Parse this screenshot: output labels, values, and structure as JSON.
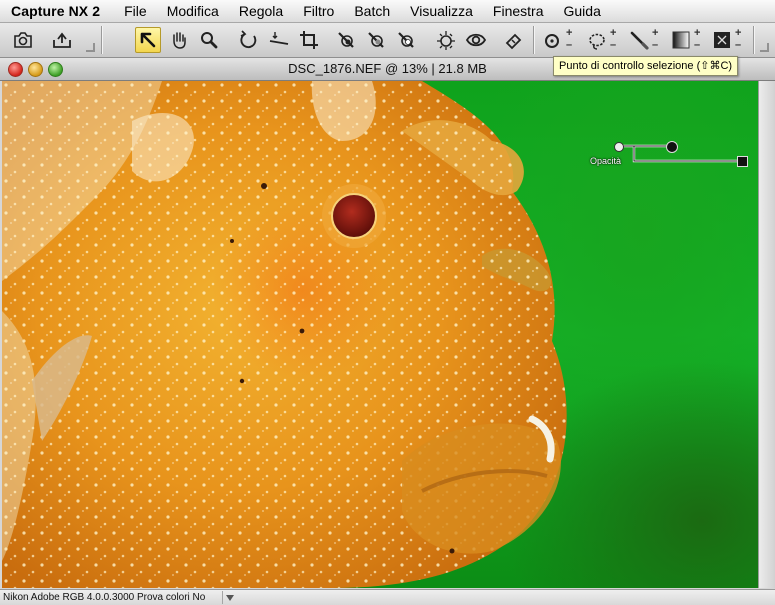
{
  "app": {
    "name": "Capture NX 2"
  },
  "menu": {
    "items": [
      "File",
      "Modifica",
      "Regola",
      "Filtro",
      "Batch",
      "Visualizza",
      "Finestra",
      "Guida"
    ]
  },
  "toolbar": {
    "tools": [
      {
        "name": "camera-icon"
      },
      {
        "name": "export-icon"
      },
      {
        "name": "direct-selection-icon",
        "active": true
      },
      {
        "name": "hand-icon"
      },
      {
        "name": "zoom-icon"
      },
      {
        "name": "rotate-icon"
      },
      {
        "name": "straighten-icon"
      },
      {
        "name": "crop-icon"
      },
      {
        "name": "black-dropper-icon"
      },
      {
        "name": "neutral-dropper-icon"
      },
      {
        "name": "white-dropper-icon"
      },
      {
        "name": "red-eye-icon"
      },
      {
        "name": "eye-icon"
      },
      {
        "name": "auto-retouch-icon"
      },
      {
        "name": "selection-control-point-icon"
      },
      {
        "name": "lasso-icon"
      },
      {
        "name": "brush-icon"
      },
      {
        "name": "gradient-icon"
      },
      {
        "name": "fill-icon"
      }
    ],
    "tooltip": "Punto di controllo selezione (⇧⌘C)"
  },
  "document": {
    "title": "DSC_1876.NEF @ 13% | 21.8 MB",
    "control_point": {
      "label": "Opacità"
    }
  },
  "statusbar": {
    "text": "Nikon Adobe RGB 4.0.0.3000  Prova colori No"
  },
  "colors": {
    "background_green": "#12a522",
    "fish_orange": "#e89a1c",
    "eye_red": "#8b1a14",
    "tooltip_bg": "#ffffc6"
  }
}
